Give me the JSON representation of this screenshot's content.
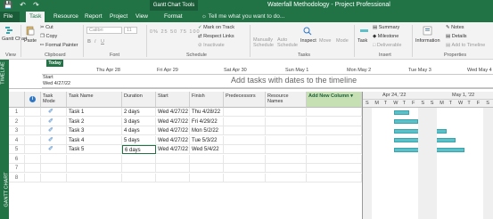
{
  "titlebar": {
    "contextual_group": "Gantt Chart Tools",
    "document_title": "Waterfall Methodology - Project Professional"
  },
  "tabs": [
    "File",
    "Task",
    "Resource",
    "Report",
    "Project",
    "View",
    "Format"
  ],
  "tell_me": "Tell me what you want to do...",
  "ribbon": {
    "gantt_chart": "Gantt Chart",
    "paste": "Paste",
    "cut": "Cut",
    "copy": "Copy",
    "format_painter": "Format Painter",
    "font_name": "Calibri",
    "font_size": "11",
    "mark_on_track": "Mark on Track",
    "respect_links": "Respect Links",
    "inactivate": "Inactivate",
    "manually_schedule": "Manually Schedule",
    "auto_schedule": "Auto Schedule",
    "inspect": "Inspect",
    "move": "Move",
    "mode": "Mode",
    "task": "Task",
    "summary": "Summary",
    "milestone": "Milestone",
    "deliverable": "Deliverable",
    "information": "Information",
    "notes": "Notes",
    "details": "Details",
    "add_to_timeline": "Add to Timeline",
    "groups": {
      "view": "View",
      "clipboard": "Clipboard",
      "font": "Font",
      "schedule": "Schedule",
      "tasks": "Tasks",
      "insert": "Insert",
      "properties": "Properties"
    }
  },
  "timeline": {
    "side_label": "TIMELINE",
    "today": "Today",
    "start_label": "Start",
    "start_date": "Wed 4/27/22",
    "ticks": [
      "Thu Apr 28",
      "Fri Apr 29",
      "Sat Apr 30",
      "Sun May 1",
      "Mon May 2",
      "Tue May 3",
      "Wed May 4"
    ],
    "placeholder": "Add tasks with dates to the timeline"
  },
  "gantt": {
    "side_label": "GANTT CHART",
    "columns": {
      "task_mode": "Task Mode",
      "task_name": "Task Name",
      "duration": "Duration",
      "start": "Start",
      "finish": "Finish",
      "predecessors": "Predecessors",
      "resource_names": "Resource Names",
      "add_new_column": "Add New Column"
    },
    "rows": [
      {
        "id": "1",
        "name": "Task 1",
        "duration": "2 days",
        "start": "Wed 4/27/22",
        "finish": "Thu 4/28/22"
      },
      {
        "id": "2",
        "name": "Task 2",
        "duration": "3 days",
        "start": "Wed 4/27/22",
        "finish": "Fri 4/29/22"
      },
      {
        "id": "3",
        "name": "Task 3",
        "duration": "4 days",
        "start": "Wed 4/27/22",
        "finish": "Mon 5/2/22"
      },
      {
        "id": "4",
        "name": "Task 4",
        "duration": "5 days",
        "start": "Wed 4/27/22",
        "finish": "Tue 5/3/22"
      },
      {
        "id": "5",
        "name": "Task 5",
        "duration": "6 days",
        "start": "Wed 4/27/22",
        "finish": "Wed 5/4/22"
      }
    ],
    "empty_row_numbers": [
      "6",
      "7",
      "8"
    ],
    "timescale_top": [
      "Apr 24, '22",
      "May 1, '22"
    ],
    "timescale_days": [
      "S",
      "M",
      "T",
      "W",
      "T",
      "F",
      "S",
      "S",
      "M",
      "T",
      "W",
      "T",
      "F",
      "S"
    ]
  },
  "colors": {
    "brand": "#217346",
    "bar": "#5bc0c8",
    "add_column": "#c6e0b4"
  }
}
